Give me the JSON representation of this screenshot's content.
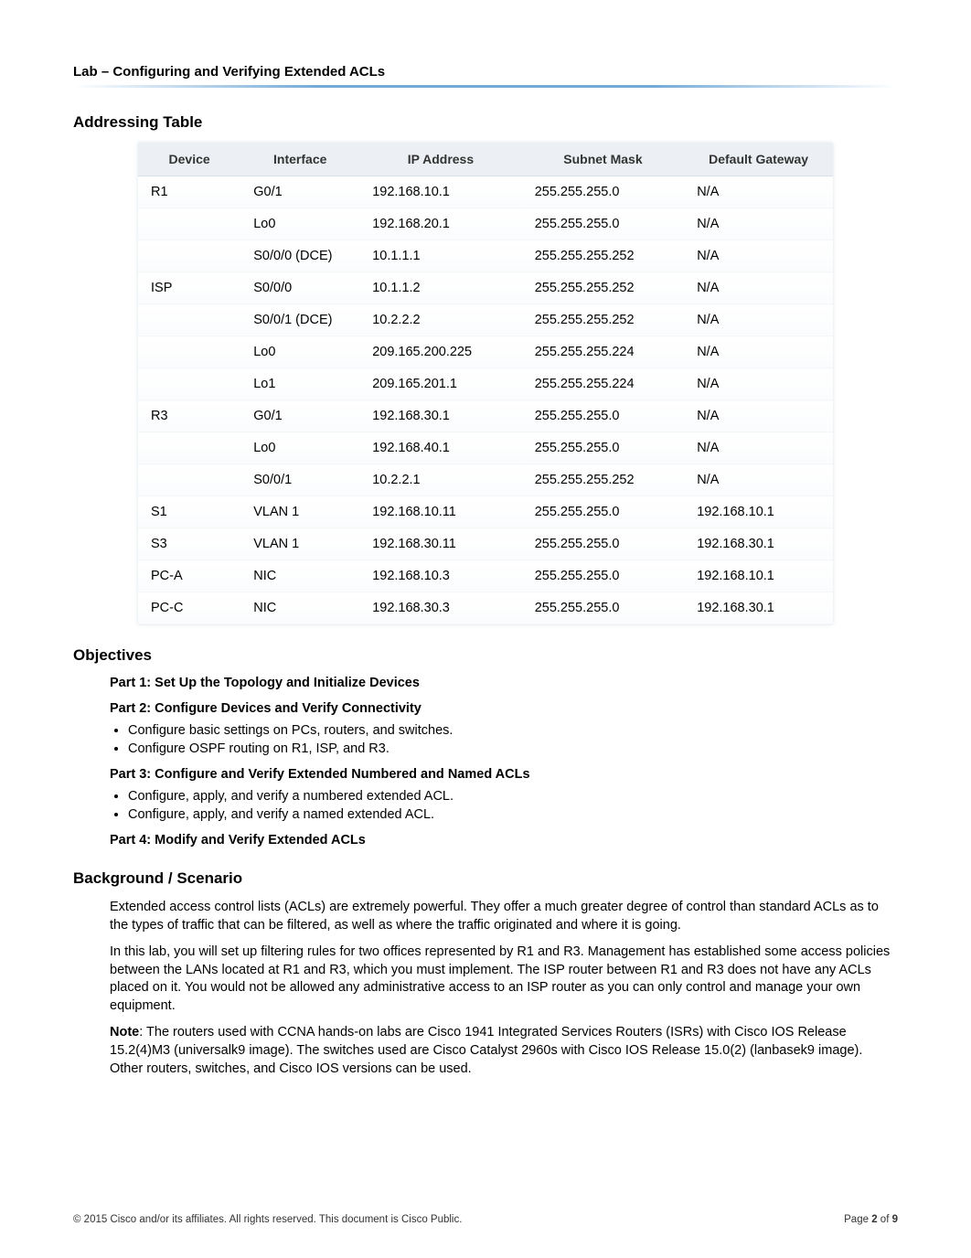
{
  "header": {
    "doc_title": "Lab – Configuring and Verifying Extended ACLs"
  },
  "addressing": {
    "section_title": "Addressing Table",
    "columns": {
      "device": "Device",
      "interface": "Interface",
      "ip": "IP Address",
      "mask": "Subnet Mask",
      "gateway": "Default Gateway"
    },
    "rows": [
      {
        "device": "R1",
        "interface": "G0/1",
        "ip": "192.168.10.1",
        "mask": "255.255.255.0",
        "gateway": "N/A"
      },
      {
        "device": "",
        "interface": "Lo0",
        "ip": "192.168.20.1",
        "mask": "255.255.255.0",
        "gateway": "N/A"
      },
      {
        "device": "",
        "interface": "S0/0/0 (DCE)",
        "ip": "10.1.1.1",
        "mask": "255.255.255.252",
        "gateway": "N/A"
      },
      {
        "device": "ISP",
        "interface": "S0/0/0",
        "ip": "10.1.1.2",
        "mask": "255.255.255.252",
        "gateway": "N/A"
      },
      {
        "device": "",
        "interface": "S0/0/1 (DCE)",
        "ip": "10.2.2.2",
        "mask": "255.255.255.252",
        "gateway": "N/A"
      },
      {
        "device": "",
        "interface": "Lo0",
        "ip": "209.165.200.225",
        "mask": "255.255.255.224",
        "gateway": "N/A"
      },
      {
        "device": "",
        "interface": "Lo1",
        "ip": "209.165.201.1",
        "mask": "255.255.255.224",
        "gateway": "N/A"
      },
      {
        "device": "R3",
        "interface": "G0/1",
        "ip": "192.168.30.1",
        "mask": "255.255.255.0",
        "gateway": "N/A"
      },
      {
        "device": "",
        "interface": "Lo0",
        "ip": "192.168.40.1",
        "mask": "255.255.255.0",
        "gateway": "N/A"
      },
      {
        "device": "",
        "interface": "S0/0/1",
        "ip": "10.2.2.1",
        "mask": "255.255.255.252",
        "gateway": "N/A"
      },
      {
        "device": "S1",
        "interface": "VLAN 1",
        "ip": "192.168.10.11",
        "mask": "255.255.255.0",
        "gateway": "192.168.10.1"
      },
      {
        "device": "S3",
        "interface": "VLAN 1",
        "ip": "192.168.30.11",
        "mask": "255.255.255.0",
        "gateway": "192.168.30.1"
      },
      {
        "device": "PC-A",
        "interface": "NIC",
        "ip": "192.168.10.3",
        "mask": "255.255.255.0",
        "gateway": "192.168.10.1"
      },
      {
        "device": "PC-C",
        "interface": "NIC",
        "ip": "192.168.30.3",
        "mask": "255.255.255.0",
        "gateway": "192.168.30.1"
      }
    ]
  },
  "objectives": {
    "section_title": "Objectives",
    "part1": "Part 1: Set Up the Topology and Initialize Devices",
    "part2": "Part 2: Configure Devices and Verify Connectivity",
    "part2_bullets": [
      "Configure basic settings on PCs, routers, and switches.",
      "Configure OSPF routing on R1, ISP, and R3."
    ],
    "part3": "Part 3: Configure and Verify Extended Numbered and Named ACLs",
    "part3_bullets": [
      "Configure, apply, and verify a numbered extended ACL.",
      "Configure, apply, and verify a named extended ACL."
    ],
    "part4": "Part 4: Modify and Verify Extended ACLs"
  },
  "background": {
    "section_title": "Background / Scenario",
    "p1": "Extended access control lists (ACLs) are extremely powerful. They offer a much greater degree of control than standard ACLs as to the types of traffic that can be filtered, as well as where the traffic originated and where it is going.",
    "p2": "In this lab, you will set up filtering rules for two offices represented by R1 and R3. Management has established some access policies between the LANs located at R1 and R3, which you must implement. The ISP router between R1 and R3 does not have any ACLs placed on it. You would not be allowed any administrative access to an ISP router as you can only control and manage your own equipment.",
    "note_label": "Note",
    "note_text": ": The routers used with CCNA hands-on labs are Cisco 1941 Integrated Services Routers (ISRs) with Cisco IOS Release 15.2(4)M3 (universalk9 image). The switches used are Cisco Catalyst 2960s with Cisco IOS Release 15.0(2) (lanbasek9 image). Other routers, switches, and Cisco IOS versions can be used."
  },
  "footer": {
    "left": "© 2015 Cisco and/or its affiliates. All rights reserved. This document is Cisco Public.",
    "right_prefix": "Page ",
    "right_page": "2",
    "right_of": " of ",
    "right_total": "9"
  }
}
